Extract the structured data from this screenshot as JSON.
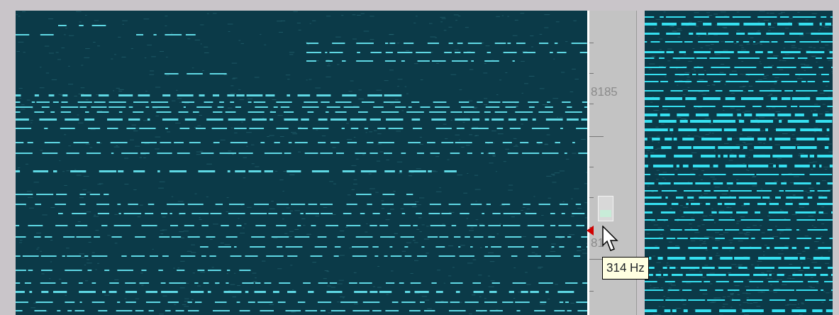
{
  "frequency_scale": {
    "labels": [
      "8185",
      "81"
    ]
  },
  "tooltip": {
    "text": "314 Hz"
  }
}
